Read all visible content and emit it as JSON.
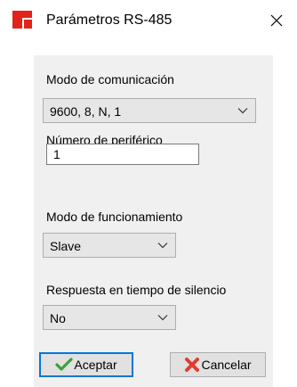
{
  "window": {
    "title": "Parámetros RS-485"
  },
  "form": {
    "comm_mode": {
      "label": "Modo de comunicación",
      "value": "9600, 8, N, 1"
    },
    "peripheral_number": {
      "label": "Número de periférico",
      "value": "1"
    },
    "operating_mode": {
      "label": "Modo de funcionamiento",
      "value": "Slave"
    },
    "silence_response": {
      "label": "Respuesta en tiempo de silencio",
      "value": "No"
    }
  },
  "buttons": {
    "accept": "Aceptar",
    "cancel": "Cancelar"
  },
  "icons": {
    "app": "app-logo-icon",
    "close": "close-icon",
    "chevron": "chevron-down-icon",
    "accept": "check-icon",
    "cancel": "cross-icon"
  },
  "colors": {
    "accent": "#0078d7",
    "brand": "#e2231a",
    "check": "#3aa13a",
    "cross": "#e03c31"
  }
}
